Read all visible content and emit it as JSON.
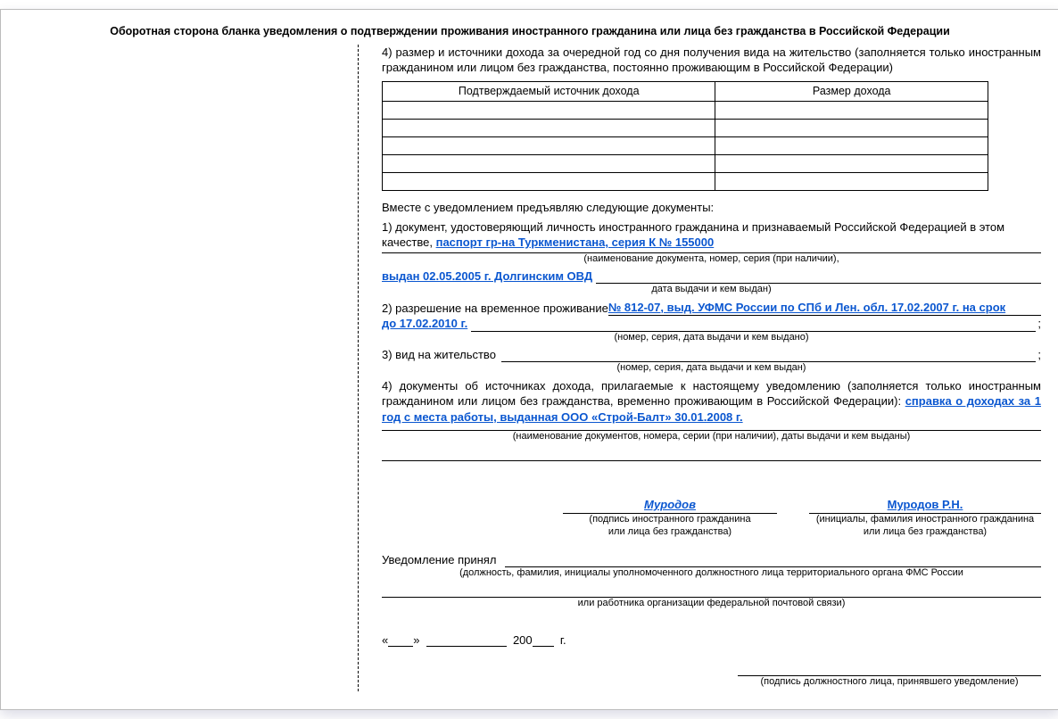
{
  "title": "Оборотная сторона бланка уведомления о подтверждении проживания иностранного гражданина или лица без гражданства в Российской Федерации",
  "item4_text": "4) размер и источники дохода за очередной год со дня получения вида на жительство (заполняется только иностранным гражданином или лицом без гражданства, постоянно проживающим в Российской Федерации)",
  "table": {
    "col1": "Подтверждаемый источник дохода",
    "col2": "Размер дохода"
  },
  "docs_intro": "Вместе с уведомлением предъявляю следующие документы:",
  "doc1_label": "1) документ, удостоверяющий личность иностранного гражданина и признаваемый Российской Федерацией в этом качестве, ",
  "doc1_value": " паспорт гр-на Туркменистана, серия К № 155000",
  "doc1_hint": "(наименование документа, номер, серия (при наличии),",
  "doc1_issued": "выдан  02.05.2005 г. Долгинским ОВД",
  "doc1_hint2": "дата выдачи и кем выдан)",
  "doc2_label": "2) разрешение на временное проживание ",
  "doc2_value": " № 812-07, выд. УФМС России по СПб и Лен. обл. 17.02.2007 г. на срок до 17.02.2010 г.",
  "doc2_hint": "(номер, серия, дата выдачи и кем выдано)",
  "doc3_label": "3) вид на жительство ",
  "doc3_hint": "(номер, серия, дата выдачи и кем выдан)",
  "doc4_text": "4) документы об источниках дохода, прилагаемые к настоящему уведомлению (заполняется только иностранным гражданином или лицом без гражданства, временно проживающим в Российской Федерации): ",
  "doc4_value": "справка о доходах за 1 год с места работы, выданная ООО «Строй-Балт» 30.01.2008 г.",
  "doc4_hint": "(наименование документов, номера, серии (при наличии), даты выдачи и кем выданы)",
  "sig_surname": "Муродов",
  "sig_hint1a": "(подпись иностранного гражданина",
  "sig_hint1b": "или лица без гражданства)",
  "sig_initials": "Муродов Р.Н.",
  "sig_hint2a": "(инициалы, фамилия иностранного гражданина",
  "sig_hint2b": "или лица без гражданства)",
  "accept_label": "Уведомление принял",
  "accept_hint1": "(должность, фамилия, инициалы уполномоченного должностного лица территориального органа ФМС России",
  "accept_hint2": "или работника организации федеральной почтовой связи)",
  "date_open": "«",
  "date_close": "»",
  "date_year_prefix": "200",
  "date_year_suffix": "г.",
  "off_sig_hint": "(подпись должностного лица, принявшего уведомление)"
}
